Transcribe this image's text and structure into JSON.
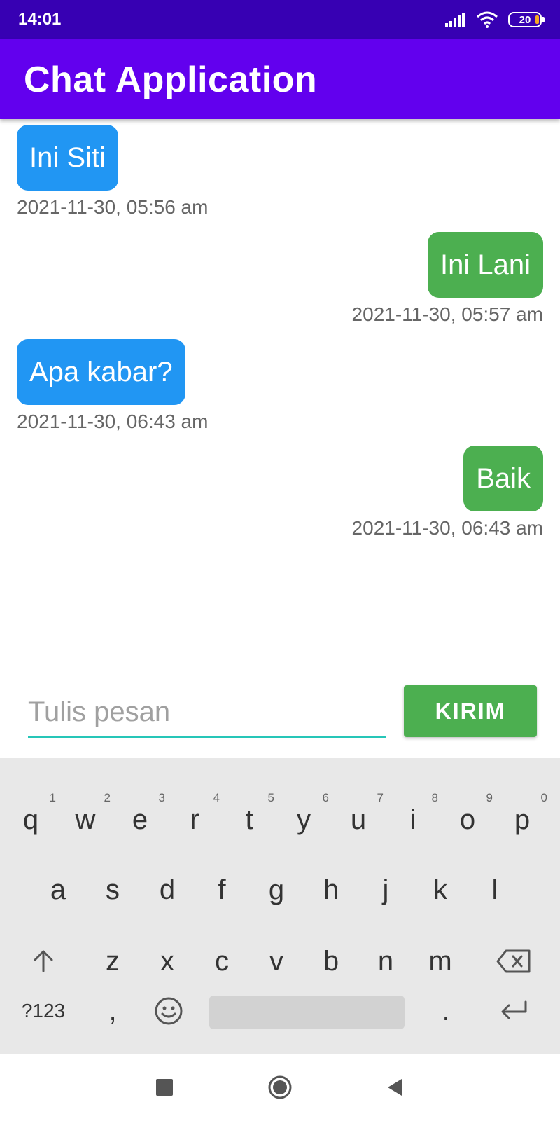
{
  "status_bar": {
    "time": "14:01",
    "battery": "20"
  },
  "app_bar": {
    "title": "Chat Application"
  },
  "messages": [
    {
      "text": "Ini Siti",
      "timestamp": "2021-11-30, 05:56 am",
      "side": "left",
      "color": "#2196f3"
    },
    {
      "text": "Ini Lani",
      "timestamp": "2021-11-30, 05:57 am",
      "side": "right",
      "color": "#4caf50"
    },
    {
      "text": "Apa kabar?",
      "timestamp": "2021-11-30, 06:43 am",
      "side": "left",
      "color": "#2196f3"
    },
    {
      "text": "Baik",
      "timestamp": "2021-11-30, 06:43 am",
      "side": "right",
      "color": "#4caf50"
    }
  ],
  "composer": {
    "placeholder": "Tulis pesan",
    "send_label": "KIRIM"
  },
  "keyboard": {
    "row1": [
      {
        "key": "q",
        "num": "1"
      },
      {
        "key": "w",
        "num": "2"
      },
      {
        "key": "e",
        "num": "3"
      },
      {
        "key": "r",
        "num": "4"
      },
      {
        "key": "t",
        "num": "5"
      },
      {
        "key": "y",
        "num": "6"
      },
      {
        "key": "u",
        "num": "7"
      },
      {
        "key": "i",
        "num": "8"
      },
      {
        "key": "o",
        "num": "9"
      },
      {
        "key": "p",
        "num": "0"
      }
    ],
    "row2": [
      "a",
      "s",
      "d",
      "f",
      "g",
      "h",
      "j",
      "k",
      "l"
    ],
    "row3": [
      "z",
      "x",
      "c",
      "v",
      "b",
      "n",
      "m"
    ],
    "symbols_label": "?123",
    "comma": ",",
    "period": "."
  },
  "colors": {
    "status_bar": "#3700b3",
    "app_bar": "#6200ee",
    "incoming": "#2196f3",
    "outgoing": "#4caf50",
    "accent": "#26c6b8"
  }
}
